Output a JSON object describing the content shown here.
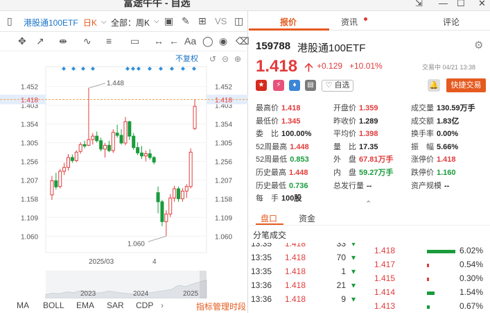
{
  "window": {
    "title": "富途牛牛 - 自选",
    "buttons": [
      "⇲",
      "—",
      "☐",
      "✕"
    ]
  },
  "toolbar": {
    "symbol_label": "港股通100ETF",
    "period": "日K",
    "scope": "全部：周K"
  },
  "chart": {
    "fq_label": "不复权",
    "vs_label": "VS"
  },
  "chart_data": {
    "type": "candlestick",
    "title": "",
    "ylim": [
      1.035,
      1.475
    ],
    "y_ticks": [
      "1.452",
      "1.403",
      "1.354",
      "1.305",
      "1.256",
      "1.207",
      "1.158",
      "1.109",
      "1.060"
    ],
    "current_price_label": "1.418",
    "high_annotation": "1.448",
    "low_annotation": "1.060",
    "x_labels": [
      "2025/03",
      "4"
    ],
    "overview_years": [
      "2023",
      "2024",
      "2025"
    ],
    "candles": [
      {
        "o": 1.168,
        "h": 1.218,
        "l": 1.155,
        "c": 1.205
      },
      {
        "o": 1.205,
        "h": 1.226,
        "l": 1.182,
        "c": 1.189
      },
      {
        "o": 1.19,
        "h": 1.236,
        "l": 1.185,
        "c": 1.23
      },
      {
        "o": 1.23,
        "h": 1.252,
        "l": 1.22,
        "c": 1.24
      },
      {
        "o": 1.24,
        "h": 1.275,
        "l": 1.232,
        "c": 1.266
      },
      {
        "o": 1.266,
        "h": 1.274,
        "l": 1.252,
        "c": 1.258
      },
      {
        "o": 1.258,
        "h": 1.285,
        "l": 1.254,
        "c": 1.28
      },
      {
        "o": 1.282,
        "h": 1.306,
        "l": 1.276,
        "c": 1.3
      },
      {
        "o": 1.3,
        "h": 1.31,
        "l": 1.29,
        "c": 1.296
      },
      {
        "o": 1.298,
        "h": 1.448,
        "l": 1.296,
        "c": 1.313
      },
      {
        "o": 1.313,
        "h": 1.33,
        "l": 1.3,
        "c": 1.322
      },
      {
        "o": 1.322,
        "h": 1.334,
        "l": 1.305,
        "c": 1.31
      },
      {
        "o": 1.31,
        "h": 1.318,
        "l": 1.282,
        "c": 1.288
      },
      {
        "o": 1.288,
        "h": 1.304,
        "l": 1.266,
        "c": 1.298
      },
      {
        "o": 1.298,
        "h": 1.31,
        "l": 1.28,
        "c": 1.284
      },
      {
        "o": 1.284,
        "h": 1.34,
        "l": 1.278,
        "c": 1.332
      },
      {
        "o": 1.33,
        "h": 1.352,
        "l": 1.318,
        "c": 1.324
      },
      {
        "o": 1.324,
        "h": 1.34,
        "l": 1.3,
        "c": 1.304
      },
      {
        "o": 1.304,
        "h": 1.372,
        "l": 1.298,
        "c": 1.36
      },
      {
        "o": 1.36,
        "h": 1.362,
        "l": 1.312,
        "c": 1.322
      },
      {
        "o": 1.322,
        "h": 1.33,
        "l": 1.286,
        "c": 1.292
      },
      {
        "o": 1.292,
        "h": 1.306,
        "l": 1.272,
        "c": 1.278
      },
      {
        "o": 1.278,
        "h": 1.296,
        "l": 1.262,
        "c": 1.27
      },
      {
        "o": 1.27,
        "h": 1.284,
        "l": 1.256,
        "c": 1.276
      },
      {
        "o": 1.276,
        "h": 1.288,
        "l": 1.26,
        "c": 1.266
      },
      {
        "o": 1.266,
        "h": 1.27,
        "l": 1.248,
        "c": 1.254
      },
      {
        "o": 1.174,
        "h": 1.19,
        "l": 1.12,
        "c": 1.15
      },
      {
        "o": 1.15,
        "h": 1.155,
        "l": 1.086,
        "c": 1.098
      },
      {
        "o": 1.098,
        "h": 1.128,
        "l": 1.06,
        "c": 1.118
      },
      {
        "o": 1.118,
        "h": 1.17,
        "l": 1.11,
        "c": 1.16
      },
      {
        "o": 1.16,
        "h": 1.192,
        "l": 1.15,
        "c": 1.184
      },
      {
        "o": 1.184,
        "h": 1.19,
        "l": 1.15,
        "c": 1.158
      },
      {
        "o": 1.158,
        "h": 1.186,
        "l": 1.15,
        "c": 1.178
      },
      {
        "o": 1.178,
        "h": 1.196,
        "l": 1.16,
        "c": 1.19
      },
      {
        "o": 1.19,
        "h": 1.29,
        "l": 1.185,
        "c": 1.28
      },
      {
        "o": 1.342,
        "h": 1.418,
        "l": 1.338,
        "c": 1.4
      }
    ]
  },
  "bottom_tabs": [
    "MA",
    "BOLL",
    "EMA",
    "SAR",
    "CDP",
    "指标管理时段"
  ],
  "tabs": {
    "quote": "报价",
    "news": "资讯",
    "comment": "评论"
  },
  "header": {
    "code": "159788",
    "name": "港股通100ETF",
    "price": "1.418",
    "change": "+0.129",
    "change_pct": "+10.01%",
    "trade_time": "交易中 04/21 13:38",
    "fav_label": "自选",
    "quick_trade": "快捷交易"
  },
  "stats": [
    {
      "k": "最高价",
      "v": "1.418",
      "c": "red"
    },
    {
      "k": "开盘价",
      "v": "1.359",
      "c": "red"
    },
    {
      "k": "成交量",
      "v": "130.59万手",
      "c": "dark"
    },
    {
      "k": "最低价",
      "v": "1.345",
      "c": "red"
    },
    {
      "k": "昨收价",
      "v": "1.289",
      "c": "dark"
    },
    {
      "k": "成交额",
      "v": "1.83亿",
      "c": "dark"
    },
    {
      "k": "委　比",
      "v": "100.00%",
      "c": "dark"
    },
    {
      "k": "平均价",
      "v": "1.398",
      "c": "red"
    },
    {
      "k": "换手率",
      "v": "0.00%",
      "c": "dark"
    },
    {
      "k": "52周最高",
      "v": "1.448",
      "c": "red"
    },
    {
      "k": "量　比",
      "v": "17.35",
      "c": "dark"
    },
    {
      "k": "振　幅",
      "v": "5.66%",
      "c": "dark"
    },
    {
      "k": "52周最低",
      "v": "0.853",
      "c": "green"
    },
    {
      "k": "外　盘",
      "v": "67.81万手",
      "c": "red"
    },
    {
      "k": "涨停价",
      "v": "1.418",
      "c": "red"
    },
    {
      "k": "历史最高",
      "v": "1.448",
      "c": "red"
    },
    {
      "k": "内　盘",
      "v": "59.27万手",
      "c": "green"
    },
    {
      "k": "跌停价",
      "v": "1.160",
      "c": "green"
    },
    {
      "k": "历史最低",
      "v": "0.736",
      "c": "green"
    },
    {
      "k": "总发行量",
      "v": "--",
      "c": "dark"
    },
    {
      "k": "资产规模",
      "v": "--",
      "c": "dark"
    },
    {
      "k": "每　手",
      "v": "100股",
      "c": "dark"
    }
  ],
  "subtabs": {
    "pankou": "盘口",
    "zichan": "资金"
  },
  "fenbi": {
    "title": "分笔成交",
    "rows": [
      {
        "time": "13:35",
        "price": "1.418",
        "vol": "33",
        "dir": "down"
      },
      {
        "time": "13:35",
        "price": "1.418",
        "vol": "70",
        "dir": "down"
      },
      {
        "time": "13:35",
        "price": "1.418",
        "vol": "1",
        "dir": "down"
      },
      {
        "time": "13:36",
        "price": "1.418",
        "vol": "21",
        "dir": "down"
      },
      {
        "time": "13:36",
        "price": "1.418",
        "vol": "9",
        "dir": "down"
      }
    ]
  },
  "depth": [
    {
      "price": "1.418",
      "pct": "6.02%",
      "fill": 0.75,
      "color": "#1a9b3c"
    },
    {
      "price": "1.417",
      "pct": "0.54%",
      "fill": 0.05,
      "color": "#e23b3b"
    },
    {
      "price": "1.415",
      "pct": "0.30%",
      "fill": 0.03,
      "color": "#e23b3b"
    },
    {
      "price": "1.414",
      "pct": "1.54%",
      "fill": 0.2,
      "color": "#1a9b3c"
    },
    {
      "price": "1.413",
      "pct": "0.67%",
      "fill": 0.08,
      "color": "#1a9b3c"
    }
  ],
  "colors": {
    "up": "#e23b3b",
    "down": "#1a9b3c",
    "accent": "#e55a1f",
    "link": "#1a73c8"
  }
}
